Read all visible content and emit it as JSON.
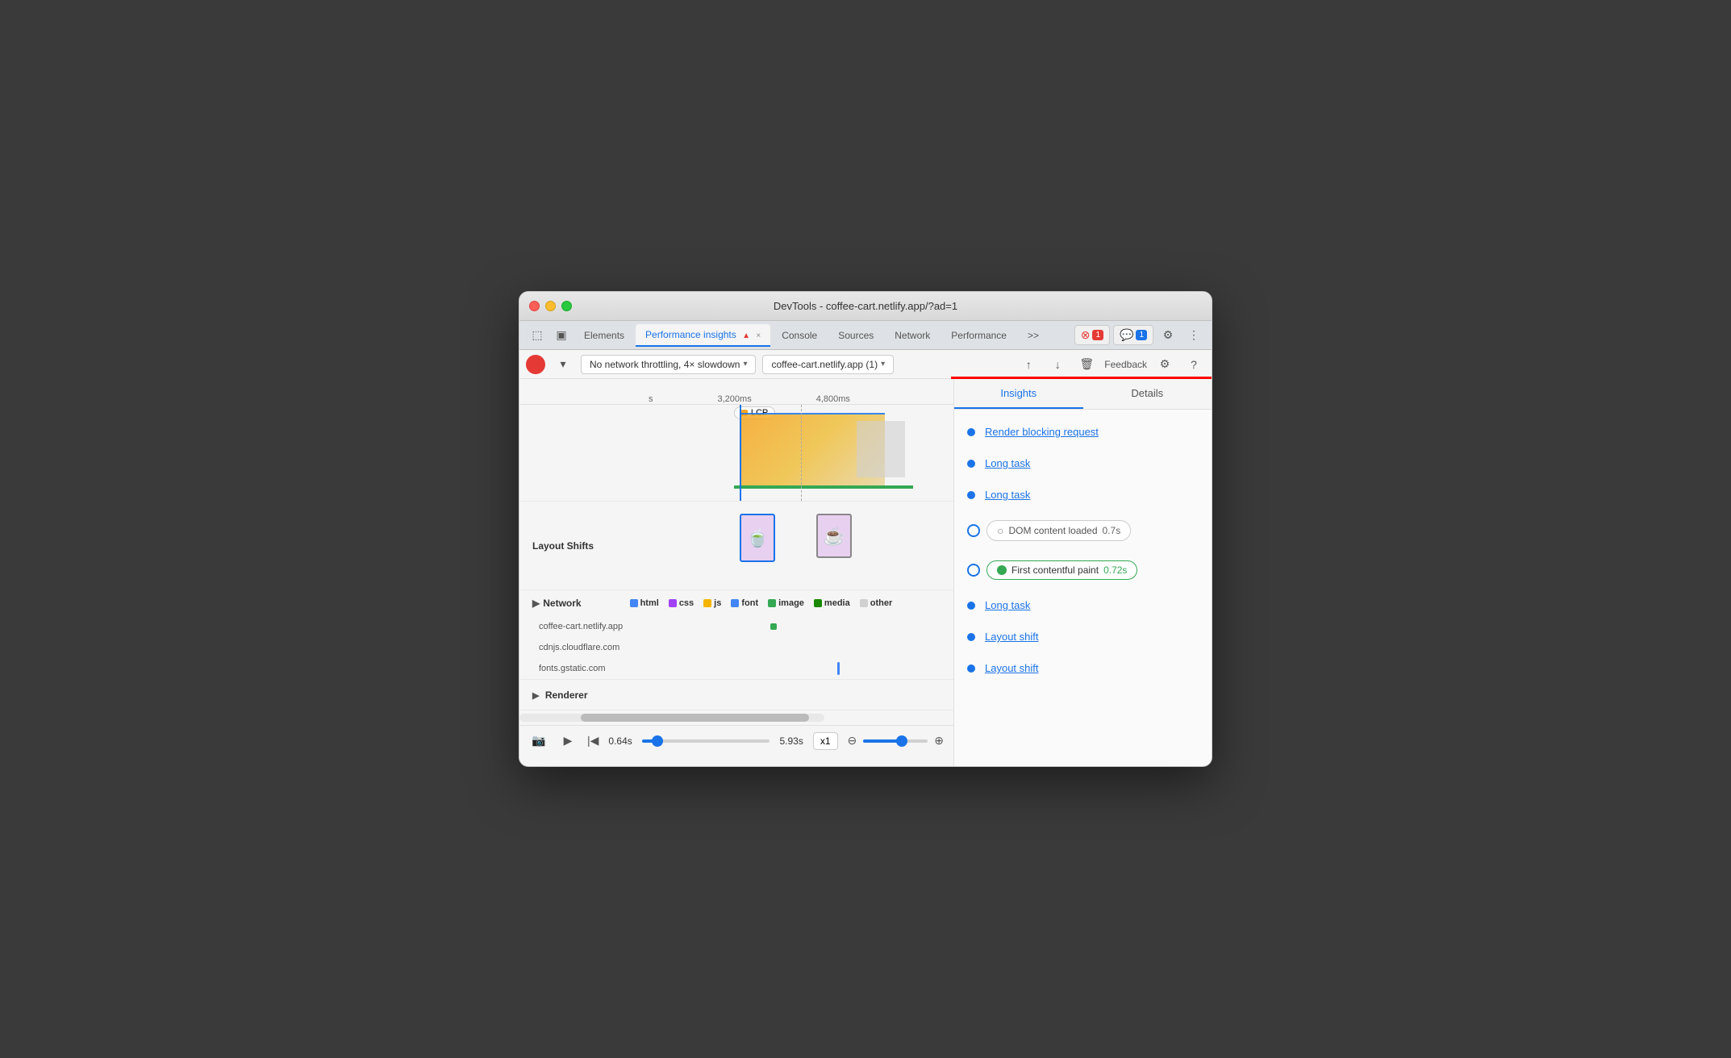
{
  "window": {
    "title": "DevTools - coffee-cart.netlify.app/?ad=1"
  },
  "tabs": {
    "items": [
      "Elements",
      "Performance insights",
      "Console",
      "Sources",
      "Network",
      "Performance",
      ">>"
    ],
    "active": "Performance insights",
    "close_label": "×"
  },
  "toolbar_right": {
    "error_count": "1",
    "message_count": "1"
  },
  "second_toolbar": {
    "throttle_label": "No network throttling, 4× slowdown",
    "profile_label": "coffee-cart.netlify.app (1)",
    "feedback_label": "Feedback"
  },
  "timeline": {
    "time_labels": [
      "s",
      "3,200ms",
      "4,800ms"
    ],
    "lcp_label": "LCP",
    "layout_shifts_label": "Layout Shifts",
    "network_label": "Network",
    "renderer_label": "Renderer"
  },
  "legend": {
    "items": [
      {
        "label": "html",
        "color": "html"
      },
      {
        "label": "css",
        "color": "css"
      },
      {
        "label": "js",
        "color": "js"
      },
      {
        "label": "font",
        "color": "font"
      },
      {
        "label": "image",
        "color": "image"
      },
      {
        "label": "media",
        "color": "media"
      },
      {
        "label": "other",
        "color": "other"
      }
    ]
  },
  "network_entries": [
    {
      "name": "coffee-cart.netlify.app"
    },
    {
      "name": "cdnjs.cloudflare.com"
    },
    {
      "name": "fonts.gstatic.com"
    }
  ],
  "bottom_bar": {
    "current_time": "0.64s",
    "total_time": "5.93s",
    "speed": "x1"
  },
  "insights_panel": {
    "tabs": [
      "Insights",
      "Details"
    ],
    "active_tab": "Insights",
    "items": [
      {
        "type": "link",
        "label": "Render blocking request"
      },
      {
        "type": "link",
        "label": "Long task"
      },
      {
        "type": "link",
        "label": "Long task"
      },
      {
        "type": "milestone_outline",
        "label": "DOM content loaded",
        "time": "0.7s"
      },
      {
        "type": "milestone_green",
        "label": "First contentful paint",
        "time": "0.72s"
      },
      {
        "type": "link",
        "label": "Long task"
      },
      {
        "type": "link",
        "label": "Layout shift"
      },
      {
        "type": "link",
        "label": "Layout shift"
      }
    ]
  }
}
